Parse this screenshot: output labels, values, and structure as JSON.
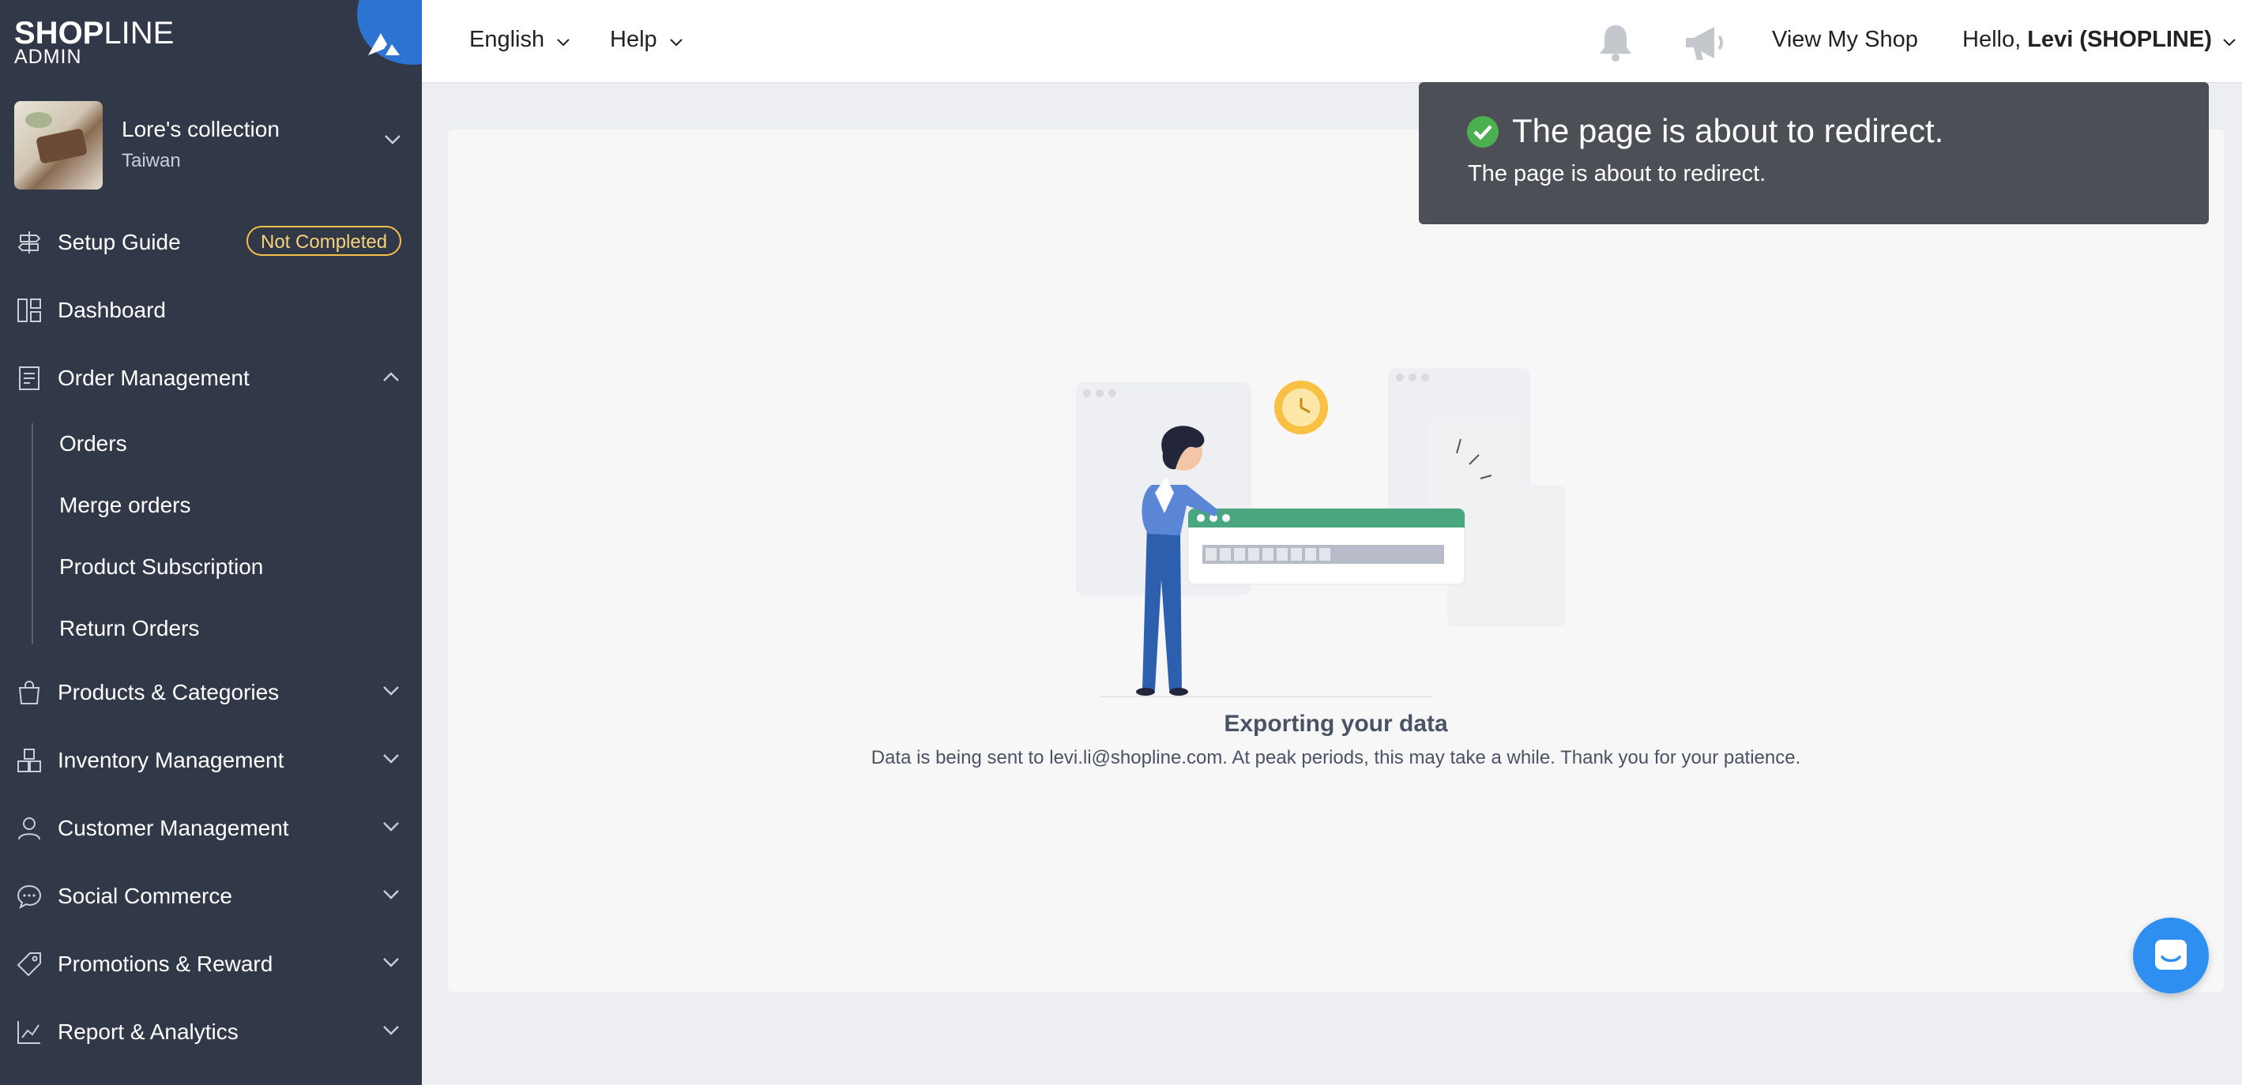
{
  "brand": {
    "logo_bold": "SHOP",
    "logo_light": "LINE",
    "logo_sub": "ADMIN"
  },
  "store": {
    "name": "Lore's collection",
    "region": "Taiwan"
  },
  "sidebar": {
    "setup_guide": {
      "label": "Setup Guide",
      "badge": "Not Completed"
    },
    "items": [
      {
        "label": "Dashboard"
      },
      {
        "label": "Order Management"
      },
      {
        "label": "Products & Categories"
      },
      {
        "label": "Inventory Management"
      },
      {
        "label": "Customer Management"
      },
      {
        "label": "Social Commerce"
      },
      {
        "label": "Promotions & Reward"
      },
      {
        "label": "Report & Analytics"
      }
    ],
    "order_subitems": [
      {
        "label": "Orders"
      },
      {
        "label": "Merge orders"
      },
      {
        "label": "Product Subscription"
      },
      {
        "label": "Return Orders"
      }
    ]
  },
  "topbar": {
    "language": "English",
    "help": "Help",
    "view_shop": "View My Shop",
    "greeting": "Hello,",
    "user": "Levi (SHOPLINE)"
  },
  "main": {
    "title": "Exporting your data",
    "description": "Data is being sent to levi.li@shopline.com. At peak periods, this may take a while. Thank you for your patience."
  },
  "toast": {
    "title": "The page is about to redirect.",
    "message": "The page is about to redirect."
  },
  "colors": {
    "sidebar_bg": "#313847",
    "accent_blue": "#2e8ff0",
    "badge_yellow": "#f5c04a",
    "success_green": "#4caf50",
    "illustration_green": "#4aa67f"
  }
}
